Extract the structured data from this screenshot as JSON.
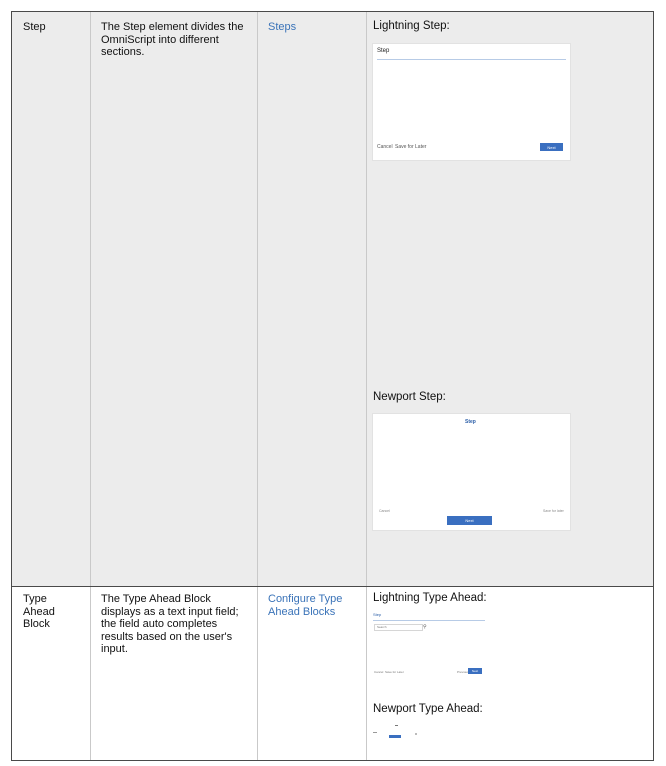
{
  "rows": [
    {
      "element": "Step",
      "description": "The Step element divides the OmniScript into different sections.",
      "link": "Steps",
      "lightning_caption": "Lightning Step:",
      "lightning_mock": {
        "title": "Step",
        "cancel": "Cancel",
        "save_later": "Save for Later",
        "next": "Next"
      },
      "newport_caption": "Newport Step:",
      "newport_mock": {
        "title": "Step",
        "cancel": "Cancel",
        "save_later": "Save for later",
        "next": "Next"
      }
    },
    {
      "element": "Type Ahead Block",
      "description": "The Type Ahead Block displays as a text input field; the field auto completes results based on the user's input.",
      "link": "Configure Type Ahead Blocks",
      "lightning_caption": "Lightning Type Ahead:",
      "lightning_mock": {
        "title": "Step",
        "input_placeholder": "Search",
        "cancel": "Cancel",
        "save_later": "Save for Later",
        "previous": "Previous",
        "next": "Next"
      },
      "newport_caption": "Newport Type Ahead:"
    }
  ],
  "colors": {
    "link": "#3a73b8",
    "accent_button": "#3a6fc0",
    "row_shade": "#ececec"
  }
}
